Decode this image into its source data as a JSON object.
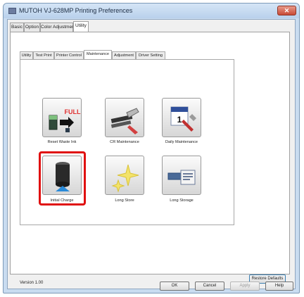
{
  "window": {
    "title": "MUTOH VJ-628MP Printing Preferences",
    "close_glyph": "✕"
  },
  "tabs": [
    {
      "label": "Basic",
      "active": false
    },
    {
      "label": "Option",
      "active": false
    },
    {
      "label": "Color Adjustment",
      "active": false
    },
    {
      "label": "Utility",
      "active": true
    }
  ],
  "subtabs": [
    {
      "label": "Utility",
      "active": false
    },
    {
      "label": "Test Print",
      "active": false
    },
    {
      "label": "Printer Control",
      "active": false
    },
    {
      "label": "Maintenance",
      "active": true
    },
    {
      "label": "Adjustment",
      "active": false
    },
    {
      "label": "Driver Setting",
      "active": false
    }
  ],
  "tiles": [
    {
      "label": "Reset Waste Ink",
      "icon": "waste-ink-full-icon",
      "icon_text": "FULL"
    },
    {
      "label": "CR Maintenance",
      "icon": "cr-maintenance-icon"
    },
    {
      "label": "Daily Maintenance",
      "icon": "calendar-tools-icon",
      "icon_text": "1"
    },
    {
      "label": "Initial Charge",
      "icon": "ink-tank-charge-icon",
      "highlighted": true
    },
    {
      "label": "Long Store",
      "icon": "sparkle-icon"
    },
    {
      "label": "Long Storage",
      "icon": "storage-card-icon"
    }
  ],
  "footer": {
    "version": "Version 1.00",
    "restore_label": "Restore Defaults",
    "ok_label": "OK",
    "cancel_label": "Cancel",
    "apply_label": "Apply",
    "help_label": "Help"
  },
  "colors": {
    "highlight": "#e01010",
    "title_bar": "#c9dcf0",
    "close_button": "#c84a36"
  }
}
